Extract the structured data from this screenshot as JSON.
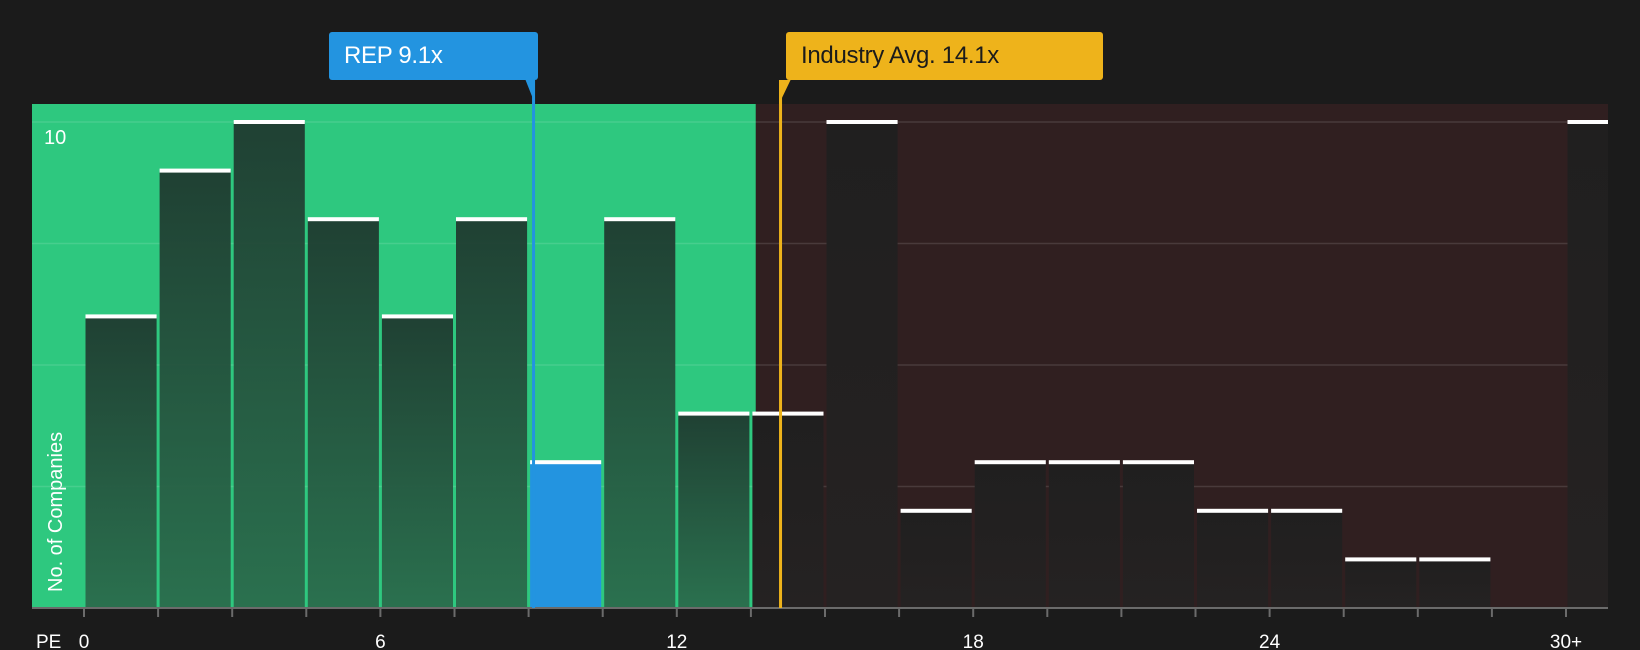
{
  "chart_data": {
    "type": "bar",
    "title": "",
    "xlabel": "PE",
    "ylabel": "No. of Companies",
    "x_tick_labels": [
      "0",
      "6",
      "12",
      "18",
      "24",
      "30+"
    ],
    "y_tick_labels": [
      "10"
    ],
    "ylim": [
      0,
      10
    ],
    "bin_width": 1.5,
    "bins": [
      {
        "start": 0,
        "count": 6
      },
      {
        "start": 1.5,
        "count": 9
      },
      {
        "start": 3,
        "count": 10
      },
      {
        "start": 4.5,
        "count": 8
      },
      {
        "start": 6,
        "count": 6
      },
      {
        "start": 7.5,
        "count": 8
      },
      {
        "start": 9,
        "count": 3,
        "highlight": true
      },
      {
        "start": 10.5,
        "count": 8
      },
      {
        "start": 12,
        "count": 4
      },
      {
        "start": 13.5,
        "count": 4
      },
      {
        "start": 15,
        "count": 10
      },
      {
        "start": 16.5,
        "count": 2
      },
      {
        "start": 18,
        "count": 3
      },
      {
        "start": 19.5,
        "count": 3
      },
      {
        "start": 21,
        "count": 3
      },
      {
        "start": 22.5,
        "count": 2
      },
      {
        "start": 24,
        "count": 2
      },
      {
        "start": 25.5,
        "count": 1
      },
      {
        "start": 27,
        "count": 1
      },
      {
        "start": 30,
        "count": 10,
        "overflow": true
      }
    ],
    "markers": [
      {
        "label": "REP 9.1x",
        "value": 9.1,
        "color": "#2394e0"
      },
      {
        "label": "Industry Avg. 14.1x",
        "value": 14.1,
        "color": "#eeb31b"
      }
    ],
    "regions": [
      {
        "from": 0,
        "to": 13.6,
        "color": "#2ec87f"
      },
      {
        "from": 13.6,
        "to": 30.8,
        "color": "#301f20"
      }
    ]
  },
  "colors": {
    "background": "#1b1b1b",
    "undervalued_region": "#2ec87f",
    "overvalued_region": "#301f20",
    "rep_marker": "#2394e0",
    "industry_marker": "#eeb31b"
  }
}
